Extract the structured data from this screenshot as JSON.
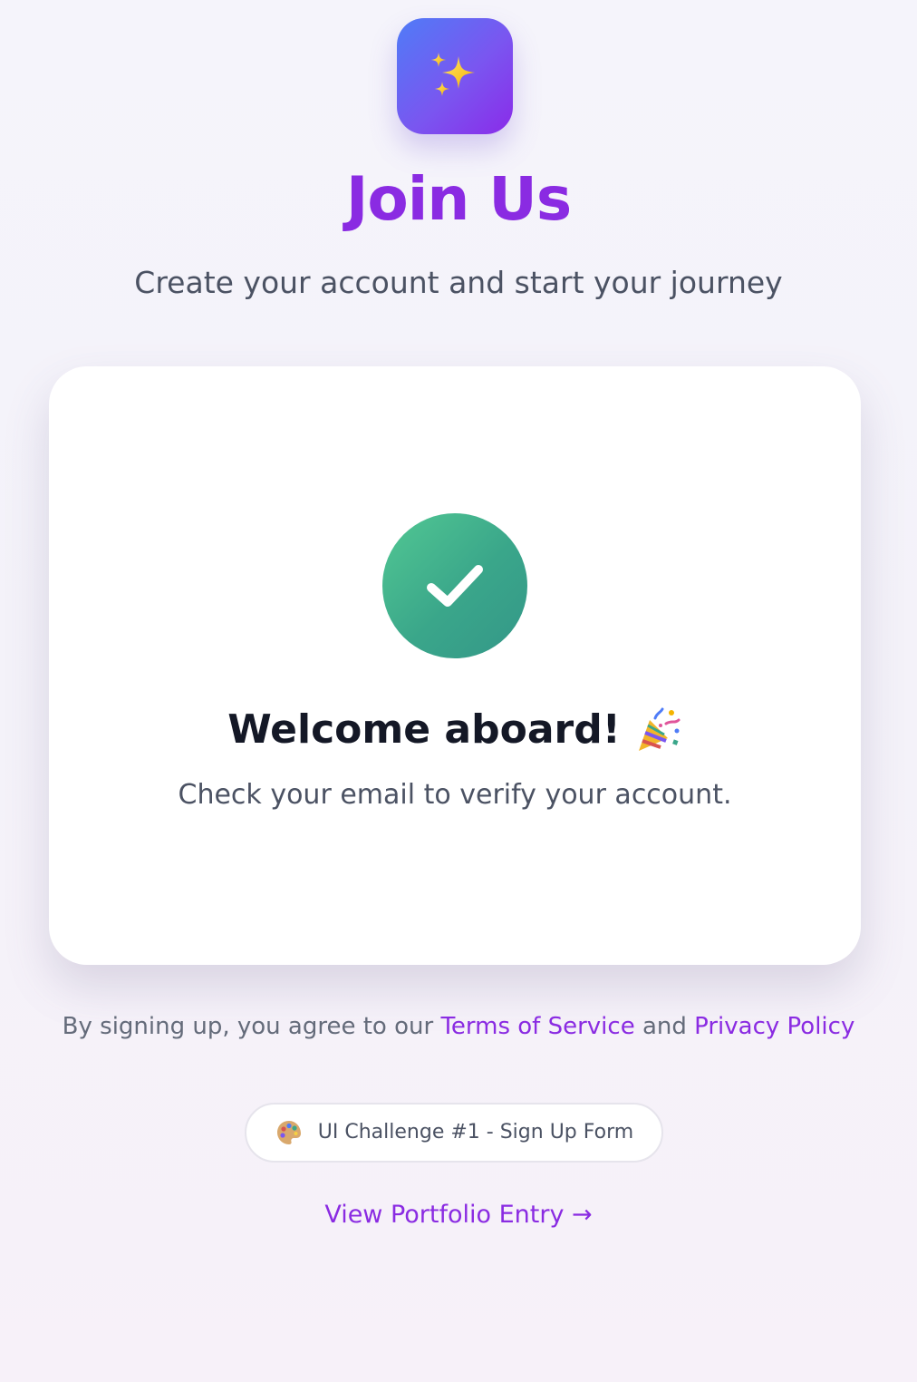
{
  "header": {
    "logo_icon": "sparkles-icon",
    "title": "Join Us",
    "subtitle": "Create your account and start your journey"
  },
  "card": {
    "status_icon": "checkmark-icon",
    "welcome_title": "Welcome aboard!",
    "welcome_emoji_icon": "party-popper-icon",
    "message": "Check your email to verify your account."
  },
  "legal": {
    "prefix": "By signing up, you agree to our ",
    "terms_link": "Terms of Service",
    "connector": " and ",
    "privacy_link": "Privacy Policy"
  },
  "challenge_badge": {
    "icon": "palette-icon",
    "label": "UI Challenge #1 - Sign Up Form"
  },
  "portfolio_link": {
    "label": "View Portfolio Entry →"
  },
  "colors": {
    "accent": "#8a2be2",
    "success": "#3aa68a",
    "logo_gradient_start": "#4f7cf7",
    "logo_gradient_end": "#8a2be9"
  }
}
